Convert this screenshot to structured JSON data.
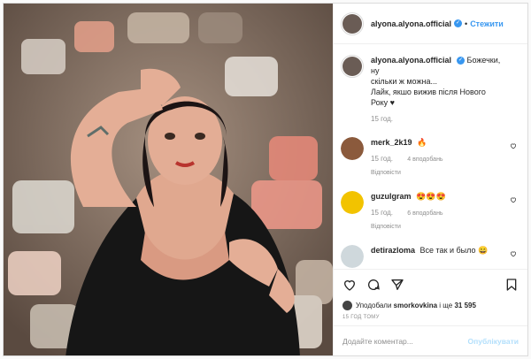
{
  "header": {
    "username": "alyona.alyona.official",
    "separator": "•",
    "follow_label": "Стежити"
  },
  "caption": {
    "username": "alyona.alyona.official",
    "text_line1": "Божечки, ну",
    "text_line2": "скільки ж можна...",
    "text_line3": "Лайк, якшо вижив після Нового",
    "text_line4": "Року ♥",
    "time": "15 год."
  },
  "comments": [
    {
      "username": "merk_2k19",
      "text": "🔥",
      "time": "15 год.",
      "likes": "4 вподобань",
      "replies": "Відповісти",
      "avatar_color": "#8b5a3c"
    },
    {
      "username": "guzulgram",
      "text": "😍😍😍",
      "time": "15 год.",
      "likes": "6 вподобань",
      "replies": "Відповісти",
      "avatar_color": "#f2c300"
    },
    {
      "username": "detirazloma",
      "text": "Все так и было 😄",
      "time": "15 год.",
      "likes": "",
      "replies": "",
      "avatar_color": "#cfd8dc"
    }
  ],
  "likes_bar": {
    "prefix": "Уподобали",
    "user": "smorkovkina",
    "middle": "і ще",
    "count": "31 595"
  },
  "timestamp": "15 ГОД ТОМУ",
  "add_comment": {
    "placeholder": "Додайте коментар...",
    "post_label": "Опублікувати"
  },
  "colors": {
    "accent": "#3897f0",
    "post_disabled": "#b2dffc",
    "text": "#262626",
    "muted": "#8e8e8e"
  },
  "icons": [
    "verified-badge-icon",
    "heart-icon",
    "comment-icon",
    "share-icon",
    "bookmark-icon"
  ]
}
